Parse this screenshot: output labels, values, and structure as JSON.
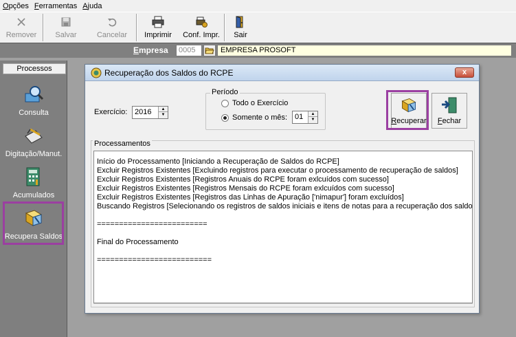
{
  "menu": {
    "items": [
      {
        "label": "Opções",
        "accel": "O"
      },
      {
        "label": "Ferramentas",
        "accel": "F"
      },
      {
        "label": "Ajuda",
        "accel": "A"
      }
    ]
  },
  "toolbar": {
    "remover": "Remover",
    "salvar": "Salvar",
    "cancelar": "Cancelar",
    "imprimir": "Imprimir",
    "conf_impr": "Conf. Impr.",
    "sair": "Sair"
  },
  "empresa": {
    "label": "Empresa",
    "code": "0005",
    "name": "EMPRESA  PROSOFT"
  },
  "left_panel": {
    "header": "Processos",
    "items": [
      "Consulta",
      "Digitação/Manut.",
      "Acumulados",
      "Recupera Saldos"
    ]
  },
  "dialog": {
    "title": "Recuperação dos Saldos do RCPE",
    "close": "x",
    "exercicio_label": "Exercício:",
    "exercicio_value": "2016",
    "periodo_title": "Período",
    "radio_todo": "Todo o Exercício",
    "radio_mes": "Somente o mês:",
    "mes_value": "01",
    "btn_recuperar": "Recuperar",
    "btn_fechar": "Fechar",
    "processamentos_title": "Processamentos",
    "log_lines": [
      "Início do Processamento [Iniciando a Recuperação de Saldos do RCPE]",
      "Excluir Registros Existentes [Excluindo registros para executar o processamento de recuperação de saldos]",
      "Excluir Registros Existentes [Registros Anuais do RCPE foram exlcuídos com sucesso]",
      "Excluir Registros Existentes [Registros Mensais do RCPE foram exlcuídos com sucesso]",
      "Excluir Registros Existentes [Registros das Linhas de Apuração ['nimapur'] foram excluídos]",
      "Buscando Registros [Selecionando os registros de saldos iniciais e itens de notas para a recuperação dos saldos]",
      "",
      "=========================",
      "",
      "Final do Processamento",
      "",
      "=========================="
    ]
  },
  "colors": {
    "highlight": "#9b3fa1",
    "panel": "#7f7f7f",
    "empresa_field": "#ffffe1"
  }
}
